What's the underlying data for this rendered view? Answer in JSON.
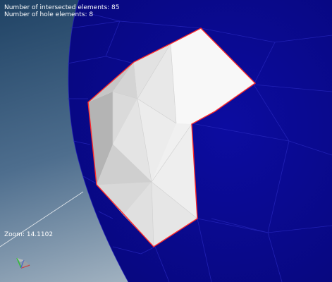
{
  "stats": {
    "intersected_label": "Number of intersected elements:",
    "intersected_value": "85",
    "hole_label": "Number of hole elements:",
    "hole_value": "8"
  },
  "zoom": {
    "label": "Zoom:",
    "value": "14.1102"
  },
  "colors": {
    "background_top": "#1f4264",
    "background_bottom": "#9fb0bf",
    "mesh_blue": "#0a0a8c",
    "mesh_lines": "#2020b0",
    "patch_white": "#f2f2f2",
    "patch_shadow": "#b8b8b8",
    "outline_red": "#ff2a2a"
  },
  "icons": {
    "axis_triad": "axis-triad-icon"
  }
}
